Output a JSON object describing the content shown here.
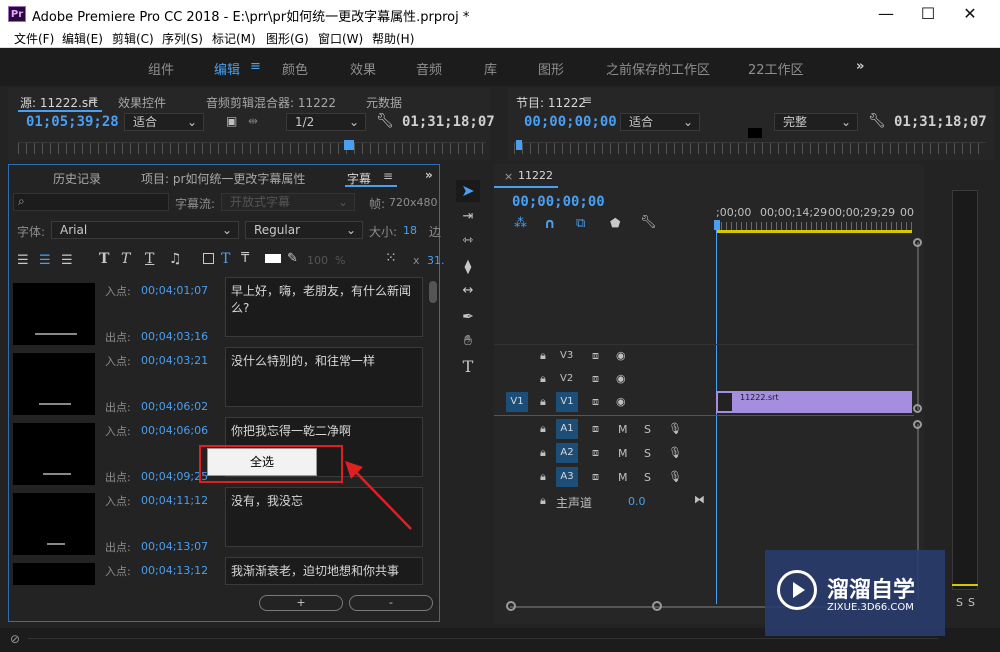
{
  "window": {
    "app_icon": "Pr",
    "title": "Adobe Premiere Pro CC 2018 - E:\\prr\\pr如何统一更改字幕属性.prproj *",
    "minimize": "—",
    "maximize": "☐",
    "close": "✕"
  },
  "menu": [
    "文件(F)",
    "编辑(E)",
    "剪辑(C)",
    "序列(S)",
    "标记(M)",
    "图形(G)",
    "窗口(W)",
    "帮助(H)"
  ],
  "workspaces": [
    "组件",
    "编辑",
    "颜色",
    "效果",
    "音频",
    "库",
    "图形",
    "之前保存的工作区",
    "22工作区"
  ],
  "workspace_more": "»",
  "source": {
    "tabs": [
      "源: 11222.srt",
      "效果控件",
      "音频剪辑混合器: 11222",
      "元数据"
    ],
    "timecode": "01;05;39;28",
    "fit": "适合",
    "ratio": "1/2",
    "duration": "01;31;18;07"
  },
  "program": {
    "tab": "节目: 11222",
    "timecode": "00;00;00;00",
    "fit": "适合",
    "quality": "完整",
    "duration": "01;31;18;07"
  },
  "captions": {
    "tabs": [
      "历史记录",
      "项目: pr如何统一更改字幕属性",
      "字幕"
    ],
    "caption_stream_label": "字幕流:",
    "caption_stream_value": "开放式字幕",
    "frame_label": "帧:",
    "frame_value": "720x480",
    "font_label": "字体:",
    "font_value": "Arial",
    "style_value": "Regular",
    "size_label": "大小:",
    "size_value": "18",
    "edge_label": "边",
    "opacity": "100",
    "opacity_unit": "%",
    "x_label": "x",
    "x_value": "31.",
    "in_label": "入点:",
    "out_label": "出点:",
    "rows": [
      {
        "in": "00;04;01;07",
        "out": "00;04;03;16",
        "text": "早上好，嗨，老朋友，有什么新闻么?"
      },
      {
        "in": "00;04;03;21",
        "out": "00;04;06;02",
        "text": "没什么特别的，和往常一样"
      },
      {
        "in": "00;04;06;06",
        "out": "00;04;09;25",
        "text": "你把我忘得一乾二净啊"
      },
      {
        "in": "00;04;11;12",
        "out": "00;04;13;07",
        "text": "没有，我没忘"
      },
      {
        "in": "00;04;13;12",
        "out": "",
        "text": "我渐渐衰老，迫切地想和你共事"
      }
    ],
    "add_button": "+",
    "remove_button": "-",
    "context_menu_item": "全选"
  },
  "timeline": {
    "tab": "11222",
    "timecode": "00;00;00;00",
    "ruler_labels": [
      ";00;00",
      "00;00;14;29",
      "00;00;29;29",
      "00"
    ],
    "video_tracks": [
      "V3",
      "V2",
      "V1"
    ],
    "audio_tracks": [
      "A1",
      "A2",
      "A3"
    ],
    "source_patch": "V1",
    "master_label": "主声道",
    "master_value": "0.0",
    "clip_name": "11222.srt",
    "m_label": "M",
    "s_label": "S"
  },
  "meter": {
    "labels": [
      "S",
      "S"
    ]
  },
  "watermark": {
    "title": "溜溜自学",
    "url": "ZIXUE.3D66.COM"
  },
  "colors": {
    "accent": "#4a9ff0",
    "clip": "#a58de0",
    "highlight_red": "#e02020"
  }
}
